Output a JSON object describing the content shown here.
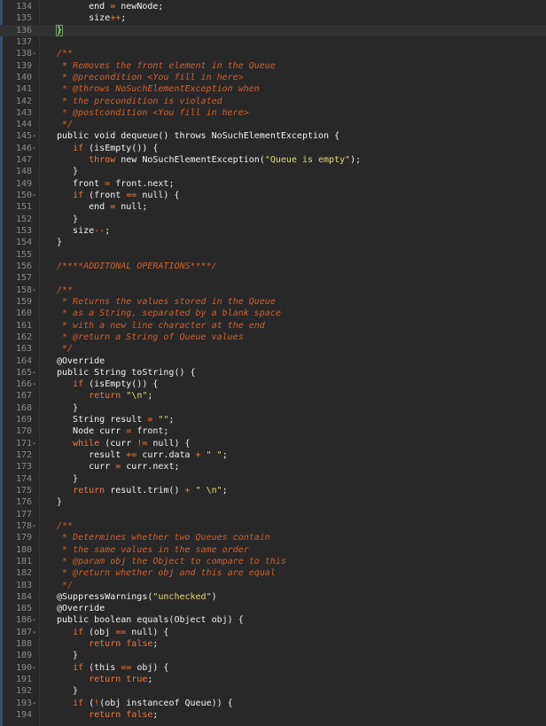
{
  "editor": {
    "lines": [
      {
        "n": "134",
        "segs": [
          [
            "plain",
            "end "
          ],
          [
            "op",
            "="
          ],
          [
            "plain",
            " newNode;"
          ]
        ]
      },
      {
        "n": "135",
        "segs": [
          [
            "plain",
            "size"
          ],
          [
            "op",
            "++"
          ],
          [
            "plain",
            ";"
          ]
        ]
      },
      {
        "n": "136",
        "segs": [
          [
            "brace",
            "}"
          ]
        ],
        "active": true
      },
      {
        "n": "137",
        "segs": []
      },
      {
        "n": "138",
        "segs": [
          [
            "cmt",
            "/**"
          ]
        ]
      },
      {
        "n": "139",
        "segs": [
          [
            "cmt",
            " * Removes the front element in the Queue"
          ]
        ]
      },
      {
        "n": "140",
        "segs": [
          [
            "cmt",
            " * @precondition <You fill in here>"
          ]
        ]
      },
      {
        "n": "141",
        "segs": [
          [
            "cmt",
            " * @throws NoSuchElementException when"
          ]
        ]
      },
      {
        "n": "142",
        "segs": [
          [
            "cmt",
            " * the precondition is violated"
          ]
        ]
      },
      {
        "n": "143",
        "segs": [
          [
            "cmt",
            " * @postcondition <You fill in here>"
          ]
        ]
      },
      {
        "n": "144",
        "segs": [
          [
            "cmt",
            " */"
          ]
        ]
      },
      {
        "n": "145",
        "segs": [
          [
            "plain",
            "public void dequeue() throws NoSuchElementException {"
          ]
        ]
      },
      {
        "n": "146",
        "segs": [
          [
            "plain",
            "   "
          ],
          [
            "kw",
            "if"
          ],
          [
            "plain",
            " (isEmpty()) {"
          ]
        ]
      },
      {
        "n": "147",
        "segs": [
          [
            "plain",
            "      "
          ],
          [
            "kw",
            "throw"
          ],
          [
            "plain",
            " new NoSuchElementException("
          ],
          [
            "str",
            "\"Queue is empty\""
          ],
          [
            "plain",
            ");"
          ]
        ]
      },
      {
        "n": "148",
        "segs": [
          [
            "plain",
            "   }"
          ]
        ]
      },
      {
        "n": "149",
        "segs": [
          [
            "plain",
            "   front "
          ],
          [
            "op",
            "="
          ],
          [
            "plain",
            " front.next;"
          ]
        ]
      },
      {
        "n": "150",
        "segs": [
          [
            "plain",
            "   "
          ],
          [
            "kw",
            "if"
          ],
          [
            "plain",
            " (front "
          ],
          [
            "op",
            "=="
          ],
          [
            "plain",
            " null) {"
          ]
        ]
      },
      {
        "n": "151",
        "segs": [
          [
            "plain",
            "      end "
          ],
          [
            "op",
            "="
          ],
          [
            "plain",
            " null;"
          ]
        ]
      },
      {
        "n": "152",
        "segs": [
          [
            "plain",
            "   }"
          ]
        ]
      },
      {
        "n": "153",
        "segs": [
          [
            "plain",
            "   size"
          ],
          [
            "op",
            "--"
          ],
          [
            "plain",
            ";"
          ]
        ]
      },
      {
        "n": "154",
        "segs": [
          [
            "plain",
            "}"
          ]
        ]
      },
      {
        "n": "155",
        "segs": []
      },
      {
        "n": "156",
        "segs": [
          [
            "cmt",
            "/****ADDITONAL OPERATIONS****/"
          ]
        ]
      },
      {
        "n": "157",
        "segs": []
      },
      {
        "n": "158",
        "segs": [
          [
            "cmt",
            "/**"
          ]
        ]
      },
      {
        "n": "159",
        "segs": [
          [
            "cmt",
            " * Returns the values stored in the Queue"
          ]
        ]
      },
      {
        "n": "160",
        "segs": [
          [
            "cmt",
            " * as a String, separated by a blank space"
          ]
        ]
      },
      {
        "n": "161",
        "segs": [
          [
            "cmt",
            " * with a new line character at the end"
          ]
        ]
      },
      {
        "n": "162",
        "segs": [
          [
            "cmt",
            " * @return a String of Queue values"
          ]
        ]
      },
      {
        "n": "163",
        "segs": [
          [
            "cmt",
            " */"
          ]
        ]
      },
      {
        "n": "164",
        "segs": [
          [
            "plain",
            "@Override"
          ]
        ]
      },
      {
        "n": "165",
        "segs": [
          [
            "plain",
            "public String toString() {"
          ]
        ]
      },
      {
        "n": "166",
        "segs": [
          [
            "plain",
            "   "
          ],
          [
            "kw",
            "if"
          ],
          [
            "plain",
            " (isEmpty()) {"
          ]
        ]
      },
      {
        "n": "167",
        "segs": [
          [
            "plain",
            "      "
          ],
          [
            "kw",
            "return"
          ],
          [
            "plain",
            " "
          ],
          [
            "str",
            "\"\\n\""
          ],
          [
            "plain",
            ";"
          ]
        ]
      },
      {
        "n": "168",
        "segs": [
          [
            "plain",
            "   }"
          ]
        ]
      },
      {
        "n": "169",
        "segs": [
          [
            "plain",
            "   String result "
          ],
          [
            "op",
            "="
          ],
          [
            "plain",
            " "
          ],
          [
            "str",
            "\"\""
          ],
          [
            "plain",
            ";"
          ]
        ]
      },
      {
        "n": "170",
        "segs": [
          [
            "plain",
            "   Node curr "
          ],
          [
            "op",
            "="
          ],
          [
            "plain",
            " front;"
          ]
        ]
      },
      {
        "n": "171",
        "segs": [
          [
            "plain",
            "   "
          ],
          [
            "kw",
            "while"
          ],
          [
            "plain",
            " (curr "
          ],
          [
            "op",
            "!="
          ],
          [
            "plain",
            " null) {"
          ]
        ]
      },
      {
        "n": "172",
        "segs": [
          [
            "plain",
            "      result "
          ],
          [
            "op",
            "+="
          ],
          [
            "plain",
            " curr.data "
          ],
          [
            "op",
            "+"
          ],
          [
            "plain",
            " "
          ],
          [
            "str",
            "\" \""
          ],
          [
            "plain",
            ";"
          ]
        ]
      },
      {
        "n": "173",
        "segs": [
          [
            "plain",
            "      curr "
          ],
          [
            "op",
            "="
          ],
          [
            "plain",
            " curr.next;"
          ]
        ]
      },
      {
        "n": "174",
        "segs": [
          [
            "plain",
            "   }"
          ]
        ]
      },
      {
        "n": "175",
        "segs": [
          [
            "plain",
            "   "
          ],
          [
            "kw",
            "return"
          ],
          [
            "plain",
            " result.trim() "
          ],
          [
            "op",
            "+"
          ],
          [
            "plain",
            " "
          ],
          [
            "str",
            "\" \\n\""
          ],
          [
            "plain",
            ";"
          ]
        ]
      },
      {
        "n": "176",
        "segs": [
          [
            "plain",
            "}"
          ]
        ]
      },
      {
        "n": "177",
        "segs": []
      },
      {
        "n": "178",
        "segs": [
          [
            "cmt",
            "/**"
          ]
        ]
      },
      {
        "n": "179",
        "segs": [
          [
            "cmt",
            " * Determines whether two Queues contain"
          ]
        ]
      },
      {
        "n": "180",
        "segs": [
          [
            "cmt",
            " * the same values in the same order"
          ]
        ]
      },
      {
        "n": "181",
        "segs": [
          [
            "cmt",
            " * @param obj the Object to compare to this"
          ]
        ]
      },
      {
        "n": "182",
        "segs": [
          [
            "cmt",
            " * @return whether obj and this are equal"
          ]
        ]
      },
      {
        "n": "183",
        "segs": [
          [
            "cmt",
            " */"
          ]
        ]
      },
      {
        "n": "184",
        "segs": [
          [
            "plain",
            "@SuppressWarnings("
          ],
          [
            "str",
            "\"unchecked\""
          ],
          [
            "plain",
            ")"
          ]
        ]
      },
      {
        "n": "185",
        "segs": [
          [
            "plain",
            "@Override"
          ]
        ]
      },
      {
        "n": "186",
        "segs": [
          [
            "plain",
            "public boolean equals(Object obj) {"
          ]
        ]
      },
      {
        "n": "187",
        "segs": [
          [
            "plain",
            "   "
          ],
          [
            "kw",
            "if"
          ],
          [
            "plain",
            " (obj "
          ],
          [
            "op",
            "=="
          ],
          [
            "plain",
            " null) {"
          ]
        ]
      },
      {
        "n": "188",
        "segs": [
          [
            "plain",
            "      "
          ],
          [
            "kw",
            "return"
          ],
          [
            "plain",
            " "
          ],
          [
            "kw",
            "false"
          ],
          [
            "plain",
            ";"
          ]
        ]
      },
      {
        "n": "189",
        "segs": [
          [
            "plain",
            "   }"
          ]
        ]
      },
      {
        "n": "190",
        "segs": [
          [
            "plain",
            "   "
          ],
          [
            "kw",
            "if"
          ],
          [
            "plain",
            " (this "
          ],
          [
            "op",
            "=="
          ],
          [
            "plain",
            " obj) {"
          ]
        ]
      },
      {
        "n": "191",
        "segs": [
          [
            "plain",
            "      "
          ],
          [
            "kw",
            "return"
          ],
          [
            "plain",
            " "
          ],
          [
            "kw",
            "true"
          ],
          [
            "plain",
            ";"
          ]
        ]
      },
      {
        "n": "192",
        "segs": [
          [
            "plain",
            "   }"
          ]
        ]
      },
      {
        "n": "193",
        "segs": [
          [
            "plain",
            "   "
          ],
          [
            "kw",
            "if"
          ],
          [
            "plain",
            " ("
          ],
          [
            "op",
            "!"
          ],
          [
            "plain",
            "(obj instanceof Queue)) {"
          ]
        ]
      },
      {
        "n": "194",
        "segs": [
          [
            "plain",
            "      "
          ],
          [
            "kw",
            "return"
          ],
          [
            "plain",
            " "
          ],
          [
            "kw",
            "false"
          ],
          [
            "plain",
            ";"
          ]
        ]
      }
    ],
    "first_line_indent": "      "
  },
  "colors": {
    "background": "#282828",
    "keyword": "#f07840",
    "string": "#e6db74",
    "comment": "#d0602f",
    "line_number": "#8a8a8a"
  }
}
